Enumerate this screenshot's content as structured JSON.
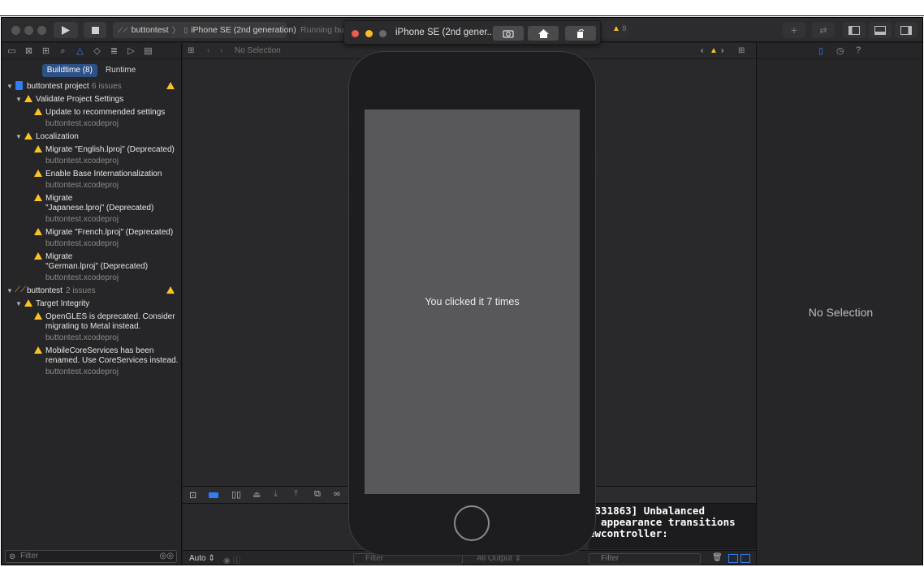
{
  "toolbar": {
    "scheme_target": "buttontest",
    "scheme_device": "iPhone SE (2nd generation)",
    "status_text": "Running butt",
    "warning_count": "8"
  },
  "navigator": {
    "segments": [
      {
        "label": "Buildtime (8)",
        "selected": true
      },
      {
        "label": "Runtime",
        "selected": false
      }
    ],
    "groups": {
      "project": {
        "name": "buttontest project",
        "count": "6 issues"
      },
      "validate": {
        "name": "Validate Project Settings"
      },
      "update": {
        "title": "Update to recommended settings",
        "file": "buttontest.xcodeproj"
      },
      "localization": {
        "name": "Localization"
      },
      "english": {
        "title": "Migrate \"English.lproj\" (Deprecated)",
        "file": "buttontest.xcodeproj"
      },
      "base": {
        "title": "Enable Base Internationalization",
        "file": "buttontest.xcodeproj"
      },
      "japanese": {
        "line1": "Migrate",
        "line2": "\"Japanese.lproj\" (Deprecated)",
        "file": "buttontest.xcodeproj"
      },
      "french": {
        "title": "Migrate \"French.lproj\" (Deprecated)",
        "file": "buttontest.xcodeproj"
      },
      "german": {
        "line1": "Migrate",
        "line2": "\"German.lproj\" (Deprecated)",
        "file": "buttontest.xcodeproj"
      },
      "target": {
        "name": "buttontest",
        "count": "2 issues"
      },
      "integrity": {
        "name": "Target Integrity"
      },
      "opengles": {
        "line1": "OpenGLES is deprecated. Consider",
        "line2": "migrating to Metal instead.",
        "file": "buttontest.xcodeproj"
      },
      "mobilecore": {
        "line1": "MobileCoreServices has been",
        "line2": "renamed. Use CoreServices instead.",
        "file": "buttontest.xcodeproj"
      }
    },
    "filter_placeholder": "Filter"
  },
  "editor": {
    "jumpbar_text": "No Selection",
    "console_lines": "2331863] Unbalanced\nd appearance transitions\newcontroller:",
    "auto_label": "Auto",
    "left_filter": "Filter",
    "output_label": "All Output",
    "right_filter": "Filter"
  },
  "inspector": {
    "empty_text": "No Selection"
  },
  "simulator": {
    "title": "iPhone SE (2nd gener...",
    "screen_text": "You clicked it 7 times"
  },
  "colors": {
    "warning": "#f7c325",
    "accent": "#2f7ef7",
    "selected_segment": "#2c5185"
  }
}
